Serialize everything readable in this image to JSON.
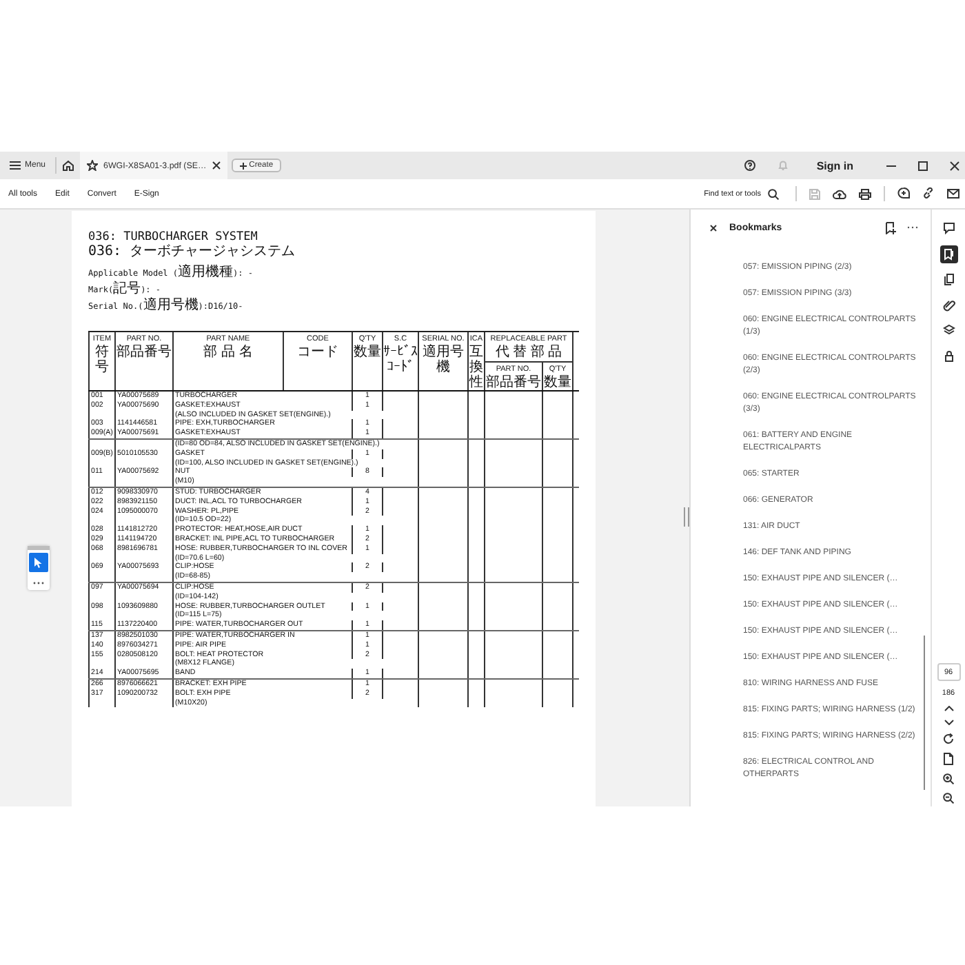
{
  "tab_bar": {
    "menu_label": "Menu",
    "tab_title": "6WGI-X8SA01-3.pdf (SE…",
    "create_label": "Create",
    "sign_in": "Sign in"
  },
  "toolbar": {
    "items": [
      "All tools",
      "Edit",
      "Convert",
      "E-Sign"
    ],
    "search_label": "Find text or tools"
  },
  "document": {
    "title": "036: TURBOCHARGER SYSTEM",
    "title_jp": "036: ターボチャージャシステム",
    "info": [
      "Applicable Model (適用機種): -",
      "Mark(記号): -",
      "Serial No.(適用号機):D16/10-"
    ],
    "table": {
      "columns": [
        {
          "label": "ITEM",
          "label_jp": "符号"
        },
        {
          "label": "PART NO.",
          "label_jp": "部品番号"
        },
        {
          "label": "PART NAME",
          "label_jp": "部 品 名"
        },
        {
          "label": "CODE",
          "label_jp": "コード"
        },
        {
          "label": "Q'TY",
          "label_jp": "数量"
        },
        {
          "label": "S.C",
          "label_jp": "ｻｰﾋﾞｽｺｰﾄﾞ"
        },
        {
          "label": "SERIAL NO.",
          "label_jp": "適用号機"
        },
        {
          "label": "ICA",
          "label_jp": "互換性"
        }
      ],
      "replaceable_part": {
        "label": "REPLACEABLE PART",
        "label_jp": "代 替 部 品",
        "columns": [
          {
            "label": "PART NO.",
            "label_jp": "部品番号"
          },
          {
            "label": "Q'TY",
            "label_jp": "数量"
          }
        ]
      },
      "rows": [
        {
          "kind": "part",
          "item": "001",
          "part_no": "YA00075689",
          "part_name": "TURBOCHARGER",
          "qty": "1",
          "group_start": false
        },
        {
          "kind": "part",
          "item": "002",
          "part_no": "YA00075690",
          "part_name": "GASKET:EXHAUST",
          "qty": "1",
          "group_start": false
        },
        {
          "kind": "note",
          "text": "(ALSO INCLUDED IN GASKET SET(ENGINE).)",
          "group_start": false
        },
        {
          "kind": "part",
          "item": "003",
          "part_no": "1141446581",
          "part_name": "PIPE: EXH,TURBOCHARGER",
          "qty": "1",
          "group_start": false
        },
        {
          "kind": "part",
          "item": "009(A)",
          "part_no": "YA00075691",
          "part_name": "GASKET:EXHAUST",
          "qty": "1",
          "group_start": false
        },
        {
          "kind": "note",
          "text": "(ID=80 OD=84, ALSO INCLUDED IN GASKET SET(ENGINE).)",
          "group_start": true
        },
        {
          "kind": "part",
          "item": "009(B)",
          "part_no": "5010105530",
          "part_name": "GASKET",
          "qty": "1",
          "group_start": false
        },
        {
          "kind": "note",
          "text": "(ID=100, ALSO INCLUDED IN GASKET SET(ENGINE).)",
          "group_start": false
        },
        {
          "kind": "part",
          "item": "011",
          "part_no": "YA00075692",
          "part_name": "NUT",
          "qty": "8",
          "group_start": false
        },
        {
          "kind": "note",
          "text": "(M10)",
          "group_start": false
        },
        {
          "kind": "part",
          "item": "012",
          "part_no": "9098330970",
          "part_name": "STUD: TURBOCHARGER",
          "qty": "4",
          "group_start": true
        },
        {
          "kind": "part",
          "item": "022",
          "part_no": "8983921150",
          "part_name": "DUCT: INL,ACL TO TURBOCHARGER",
          "qty": "1",
          "group_start": false
        },
        {
          "kind": "part",
          "item": "024",
          "part_no": "1095000070",
          "part_name": "WASHER: PL,PIPE",
          "qty": "2",
          "group_start": false
        },
        {
          "kind": "note",
          "text": "(ID=10.5 OD=22)",
          "group_start": false
        },
        {
          "kind": "part",
          "item": "028",
          "part_no": "1141812720",
          "part_name": "PROTECTOR: HEAT,HOSE,AIR DUCT",
          "qty": "1",
          "group_start": false
        },
        {
          "kind": "part",
          "item": "029",
          "part_no": "1141194720",
          "part_name": "BRACKET: INL PIPE,ACL TO TURBOCHARGER",
          "qty": "2",
          "group_start": false
        },
        {
          "kind": "part",
          "item": "068",
          "part_no": "8981696781",
          "part_name": "HOSE: RUBBER,TURBOCHARGER TO INL COVER",
          "qty": "1",
          "group_start": false
        },
        {
          "kind": "note",
          "text": "(ID=70.6 L=60)",
          "group_start": false
        },
        {
          "kind": "part",
          "item": "069",
          "part_no": "YA00075693",
          "part_name": "CLIP:HOSE",
          "qty": "2",
          "group_start": false
        },
        {
          "kind": "note",
          "text": "(ID=68-85)",
          "group_start": false
        },
        {
          "kind": "part",
          "item": "097",
          "part_no": "YA00075694",
          "part_name": "CLIP:HOSE",
          "qty": "2",
          "group_start": true
        },
        {
          "kind": "note",
          "text": "(ID=104-142)",
          "group_start": false
        },
        {
          "kind": "part",
          "item": "098",
          "part_no": "1093609880",
          "part_name": "HOSE: RUBBER,TURBOCHARGER OUTLET",
          "qty": "1",
          "group_start": false
        },
        {
          "kind": "note",
          "text": "(ID=115 L=75)",
          "group_start": false
        },
        {
          "kind": "part",
          "item": "115",
          "part_no": "1137220400",
          "part_name": "PIPE: WATER,TURBOCHARGER OUT",
          "qty": "1",
          "group_start": false
        },
        {
          "kind": "part",
          "item": "137",
          "part_no": "8982501030",
          "part_name": "PIPE: WATER,TURBOCHARGER IN",
          "qty": "1",
          "group_start": true
        },
        {
          "kind": "part",
          "item": "140",
          "part_no": "8976034271",
          "part_name": "PIPE: AIR PIPE",
          "qty": "1",
          "group_start": false
        },
        {
          "kind": "part",
          "item": "155",
          "part_no": "0280508120",
          "part_name": "BOLT: HEAT PROTECTOR",
          "qty": "2",
          "group_start": false
        },
        {
          "kind": "note",
          "text": "(M8X12 FLANGE)",
          "group_start": false
        },
        {
          "kind": "part",
          "item": "214",
          "part_no": "YA00075695",
          "part_name": "BAND",
          "qty": "1",
          "group_start": false
        },
        {
          "kind": "part",
          "item": "266",
          "part_no": "8976066621",
          "part_name": "BRACKET: EXH PIPE",
          "qty": "1",
          "group_start": true
        },
        {
          "kind": "part",
          "item": "317",
          "part_no": "1090200732",
          "part_name": "BOLT: EXH PIPE",
          "qty": "2",
          "group_start": false
        },
        {
          "kind": "note",
          "text": "(M10X20)",
          "group_start": false
        }
      ]
    }
  },
  "bookmarks": {
    "title": "Bookmarks",
    "items": [
      "057: EMISSION PIPING (2/3)",
      "057: EMISSION PIPING (3/3)",
      "060: ENGINE ELECTRICAL CONTROLPARTS (1/3)",
      "060: ENGINE ELECTRICAL CONTROLPARTS (2/3)",
      "060: ENGINE ELECTRICAL CONTROLPARTS (3/3)",
      "061: BATTERY AND ENGINE ELECTRICALPARTS",
      "065: STARTER",
      "066: GENERATOR",
      "131: AIR DUCT",
      "146: DEF TANK AND PIPING",
      "150: EXHAUST PIPE AND SILENCER (…",
      "150: EXHAUST PIPE AND SILENCER (…",
      "150: EXHAUST PIPE AND SILENCER (…",
      "150: EXHAUST PIPE AND SILENCER (…",
      "810: WIRING HARNESS AND FUSE",
      "815: FIXING PARTS; WIRING HARNESS (1/2)",
      "815: FIXING PARTS; WIRING HARNESS (2/2)",
      "826: ELECTRICAL CONTROL AND OTHERPARTS"
    ]
  },
  "rail_tools": [
    {
      "kind": "comment",
      "selected": false
    },
    {
      "kind": "bookmark",
      "selected": true
    },
    {
      "kind": "pages",
      "selected": false
    },
    {
      "kind": "attachment",
      "selected": false
    },
    {
      "kind": "layers",
      "selected": false
    },
    {
      "kind": "lock",
      "selected": false
    }
  ],
  "page_nav": {
    "current_page": "96",
    "total_pages": "186"
  }
}
